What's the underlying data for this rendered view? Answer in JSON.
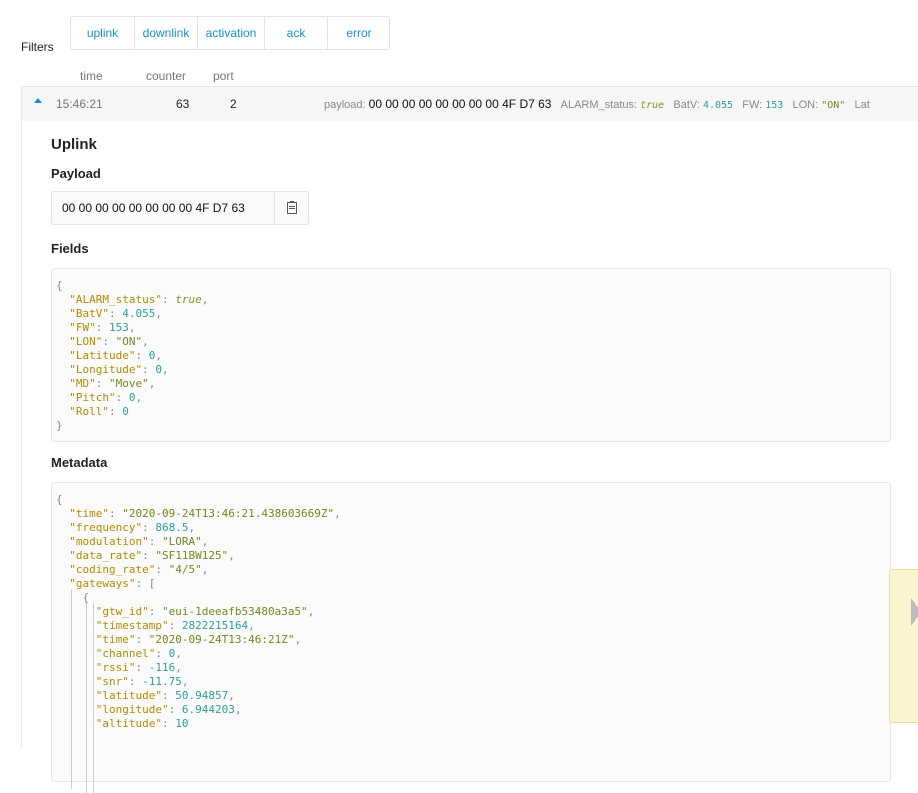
{
  "filters": {
    "label": "Filters",
    "buttons": [
      "uplink",
      "downlink",
      "activation",
      "ack",
      "error"
    ]
  },
  "columns": {
    "time": "time",
    "counter": "counter",
    "port": "port"
  },
  "message": {
    "time": "15:46:21",
    "counter": "63",
    "port": "2",
    "inline": {
      "payload_key": "payload:",
      "payload": "00 00 00 00 00 00 00 00 4F D7 63",
      "alarm_key": "ALARM_status:",
      "alarm_val": "true",
      "batv_key": "BatV:",
      "batv_val": "4.055",
      "fw_key": "FW:",
      "fw_val": "153",
      "lon_key": "LON:",
      "lon_val": "\"ON\"",
      "lat_key": "Lat"
    }
  },
  "detail": {
    "title": "Uplink",
    "payload_heading": "Payload",
    "payload_hex": "00 00 00 00 00 00 00 00 4F D7 63",
    "fields_heading": "Fields",
    "metadata_heading": "Metadata"
  },
  "fields_json": [
    [
      "{"
    ],
    [
      "ALARM_status",
      "true",
      "b",
      ","
    ],
    [
      "BatV",
      "4.055",
      "n",
      ","
    ],
    [
      "FW",
      "153",
      "n",
      ","
    ],
    [
      "LON",
      "\"ON\"",
      "s",
      ","
    ],
    [
      "Latitude",
      "0",
      "n",
      ","
    ],
    [
      "Longitude",
      "0",
      "n",
      ","
    ],
    [
      "MD",
      "\"Move\"",
      "s",
      ","
    ],
    [
      "Pitch",
      "0",
      "n",
      ","
    ],
    [
      "Roll",
      "0",
      "n",
      ""
    ],
    [
      "}"
    ]
  ],
  "metadata_json": [
    [
      "{",
      0
    ],
    [
      "time",
      "\"2020-09-24T13:46:21.438603669Z\"",
      "s",
      ",",
      1
    ],
    [
      "frequency",
      "868.5",
      "n",
      ",",
      1
    ],
    [
      "modulation",
      "\"LORA\"",
      "s",
      ",",
      1
    ],
    [
      "data_rate",
      "\"SF11BW125\"",
      "s",
      ",",
      1
    ],
    [
      "coding_rate",
      "\"4/5\"",
      "s",
      ",",
      1
    ],
    [
      "gateways",
      "[",
      "p",
      "",
      1
    ],
    [
      "{",
      2
    ],
    [
      "gtw_id",
      "\"eui-1deeafb53480a3a5\"",
      "s",
      ",",
      3
    ],
    [
      "timestamp",
      "2822215164",
      "n",
      ",",
      3
    ],
    [
      "time",
      "\"2020-09-24T13:46:21Z\"",
      "s",
      ",",
      3
    ],
    [
      "channel",
      "0",
      "n",
      ",",
      3
    ],
    [
      "rssi",
      "-116",
      "n",
      ",",
      3
    ],
    [
      "snr",
      "-11.75",
      "n",
      ",",
      3
    ],
    [
      "latitude",
      "50.94857",
      "n",
      ",",
      3
    ],
    [
      "longitude",
      "6.944203",
      "n",
      ",",
      3
    ],
    [
      "altitude",
      "10",
      "n",
      "",
      3
    ]
  ]
}
